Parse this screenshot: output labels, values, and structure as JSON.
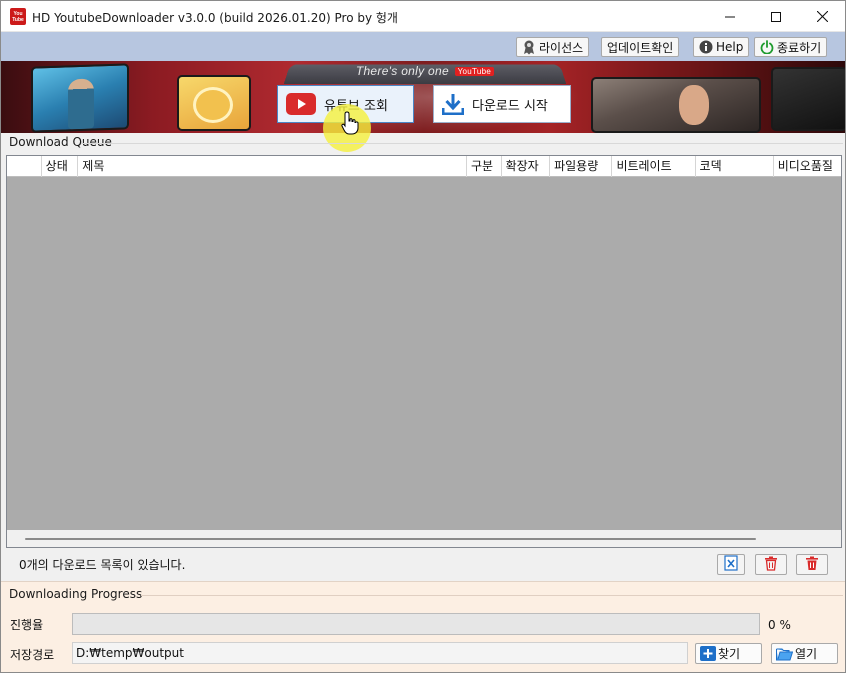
{
  "window": {
    "icon_text": "YouTube",
    "title": "HD YoutubeDownloader v3.0.0 (build 2026.01.20) Pro by 헝개",
    "minimize_icon": "minimize-icon",
    "maximize_icon": "maximize-icon",
    "close_icon": "close-icon"
  },
  "toolbar": {
    "license_label": "라이선스",
    "update_label": "업데이트확인",
    "help_label": "Help",
    "exit_label": "종료하기"
  },
  "banner": {
    "tagline": "There's only one",
    "tagline_badge": "YouTube",
    "lookup_label": "유튜브 조회",
    "start_label": "다운로드 시작"
  },
  "queue": {
    "group_label": "Download Queue",
    "columns": [
      "",
      "상태",
      "제목",
      "구분",
      "확장자",
      "파일용량",
      "비트레이트",
      "코덱",
      "비디오품질"
    ],
    "rows": [],
    "status_text": "0개의 다운로드 목록이 있습니다."
  },
  "progress": {
    "group_label": "Downloading Progress",
    "progress_label": "진행율",
    "progress_value": 0,
    "progress_text": "0 %",
    "path_label": "저장경로",
    "path_value": "D:₩temp₩output",
    "browse_label": "찾기",
    "open_label": "열기"
  },
  "colors": {
    "toolbar_band": "#b7c6e0",
    "grid_background": "#ababab",
    "progress_panel": "#fcefe3",
    "accent_red": "#d92b2b",
    "accent_blue": "#1e6fc8",
    "cursor_highlight": "#f5f03c"
  }
}
